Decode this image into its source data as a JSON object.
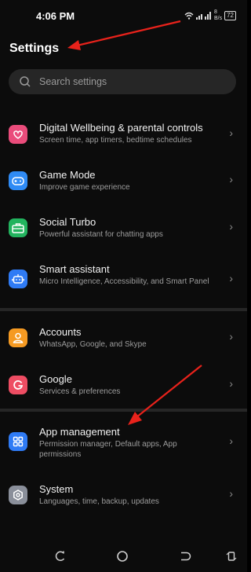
{
  "status": {
    "time": "4:06 PM",
    "speed_top": "8",
    "speed_unit": "B/s",
    "battery": "72"
  },
  "header": {
    "title": "Settings"
  },
  "search": {
    "placeholder": "Search settings"
  },
  "items": [
    {
      "label": "Digital Wellbeing & parental controls",
      "sub": "Screen time, app timers, bedtime schedules",
      "icon": "heart-icon",
      "color": "#ea4c7b"
    },
    {
      "label": "Game Mode",
      "sub": "Improve game experience",
      "icon": "gamepad-icon",
      "color": "#2f8bf5"
    },
    {
      "label": "Social Turbo",
      "sub": "Powerful assistant for chatting apps",
      "icon": "briefcase-icon",
      "color": "#22b35e"
    },
    {
      "label": "Smart assistant",
      "sub": "Micro Intelligence, Accessibility, and Smart Panel",
      "icon": "robot-icon",
      "color": "#2f7bf5"
    },
    {
      "label": "Accounts",
      "sub": "WhatsApp, Google, and Skype",
      "icon": "person-icon",
      "color": "#f59a22"
    },
    {
      "label": "Google",
      "sub": "Services & preferences",
      "icon": "google-g-icon",
      "color": "#ee4d63"
    },
    {
      "label": "App management",
      "sub": "Permission manager, Default apps, App permissions",
      "icon": "apps-grid-icon",
      "color": "#2f7bf5"
    },
    {
      "label": "System",
      "sub": "Languages, time, backup, updates",
      "icon": "gear-icon",
      "color": "#8a8f9a"
    }
  ],
  "annotation_color": "#e8221b"
}
